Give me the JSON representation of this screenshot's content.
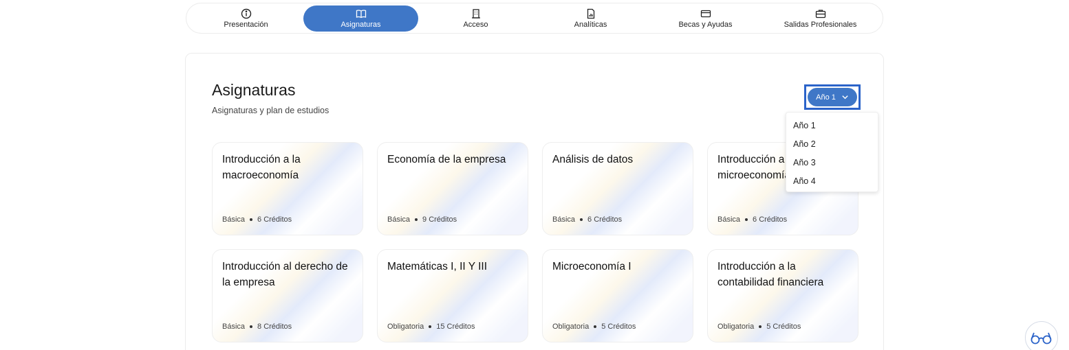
{
  "tabs": [
    {
      "label": "Presentación",
      "icon": "info-icon",
      "active": false
    },
    {
      "label": "Asignaturas",
      "icon": "book-icon",
      "active": true
    },
    {
      "label": "Acceso",
      "icon": "building-icon",
      "active": false
    },
    {
      "label": "Analíticas",
      "icon": "report-icon",
      "active": false
    },
    {
      "label": "Becas y Ayudas",
      "icon": "card-icon",
      "active": false
    },
    {
      "label": "Salidas Profesionales",
      "icon": "briefcase-icon",
      "active": false
    }
  ],
  "section": {
    "title": "Asignaturas",
    "subtitle": "Asignaturas y plan de estudios"
  },
  "year_select": {
    "selected": "Año 1",
    "options": [
      "Año 1",
      "Año 2",
      "Año 3",
      "Año 4"
    ]
  },
  "subjects": [
    {
      "title": "Introducción a la macroeconomía",
      "type": "Básica",
      "credits": "6 Créditos"
    },
    {
      "title": "Economía de la empresa",
      "type": "Básica",
      "credits": "9 Créditos"
    },
    {
      "title": "Análisis de datos",
      "type": "Básica",
      "credits": "6 Créditos"
    },
    {
      "title": "Introducción a la microeconomía",
      "type": "Básica",
      "credits": "6 Créditos"
    },
    {
      "title": "Introducción al derecho de la empresa",
      "type": "Básica",
      "credits": "8 Créditos"
    },
    {
      "title": "Matemáticas I, II Y III",
      "type": "Obligatoria",
      "credits": "15 Créditos"
    },
    {
      "title": "Microeconomía I",
      "type": "Obligatoria",
      "credits": "5 Créditos"
    },
    {
      "title": "Introducción a la contabilidad financiera",
      "type": "Obligatoria",
      "credits": "5 Créditos"
    }
  ],
  "colors": {
    "accent": "#3f77c7",
    "focus": "#2b63c9"
  }
}
